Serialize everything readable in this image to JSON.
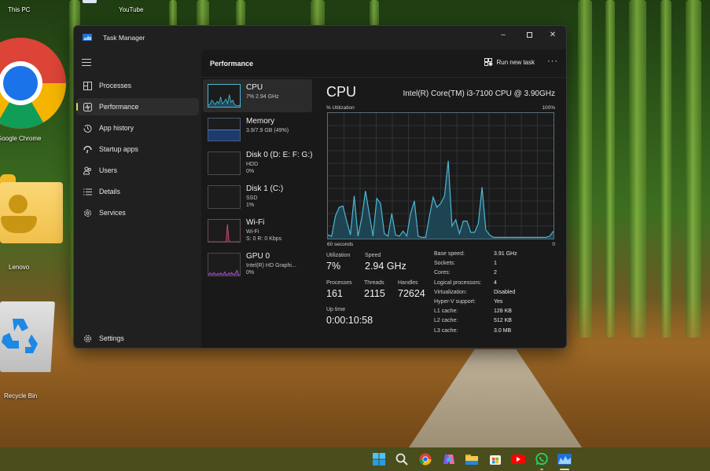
{
  "desktop": {
    "icons": [
      {
        "label": "This PC",
        "icon": "this-pc-icon"
      },
      {
        "label": "YouTube",
        "icon": "youtube-shortcut-icon"
      },
      {
        "label": "Google Chrome",
        "icon": "chrome-icon"
      },
      {
        "label": "Lenovo",
        "icon": "user-folder-icon"
      },
      {
        "label": "Recycle Bin",
        "icon": "recycle-bin-icon"
      }
    ]
  },
  "window": {
    "title": "Task Manager",
    "controls": {
      "minimize": "–",
      "maximize": "☐",
      "close": "✕"
    }
  },
  "nav": {
    "items": [
      {
        "label": "Processes",
        "icon": "processes-icon"
      },
      {
        "label": "Performance",
        "icon": "performance-icon",
        "active": true
      },
      {
        "label": "App history",
        "icon": "app-history-icon"
      },
      {
        "label": "Startup apps",
        "icon": "startup-apps-icon"
      },
      {
        "label": "Users",
        "icon": "users-icon"
      },
      {
        "label": "Details",
        "icon": "details-icon"
      },
      {
        "label": "Services",
        "icon": "services-icon"
      }
    ],
    "settings": "Settings"
  },
  "header": {
    "title": "Performance",
    "run_new_task": "Run new task",
    "more": "···"
  },
  "devices": [
    {
      "name": "CPU",
      "sub1": "7% 2.94 GHz",
      "active": true,
      "color": "#4fb6d4"
    },
    {
      "name": "Memory",
      "sub1": "3.9/7.9 GB (49%)",
      "color": "#4c7bd6"
    },
    {
      "name": "Disk 0 (D: E: F: G:)",
      "sub1": "HDD",
      "sub2": "0%",
      "color": "#6fbf4f"
    },
    {
      "name": "Disk 1 (C:)",
      "sub1": "SSD",
      "sub2": "1%",
      "color": "#6fbf4f"
    },
    {
      "name": "Wi-Fi",
      "sub1": "Wi-Fi",
      "sub2": "S: 0 R: 0 Kbps",
      "color": "#d8538a"
    },
    {
      "name": "GPU 0",
      "sub1": "Intel(R) HD Graphi...",
      "sub2": "0%",
      "color": "#b04fd0"
    }
  ],
  "cpu": {
    "title": "CPU",
    "model": "Intel(R) Core(TM) i3-7100 CPU @ 3.90GHz",
    "util_label": "% Utilization",
    "util_max": "100%",
    "axis_left": "60 seconds",
    "axis_right": "0",
    "line_color": "#4fb6d4",
    "stats": {
      "utilization_label": "Utilization",
      "utilization": "7%",
      "speed_label": "Speed",
      "speed": "2.94 GHz",
      "processes_label": "Processes",
      "processes": "161",
      "threads_label": "Threads",
      "threads": "2115",
      "handles_label": "Handles",
      "handles": "72624",
      "uptime_label": "Up time",
      "uptime": "0:00:10:58"
    },
    "specs": [
      {
        "label": "Base speed:",
        "value": "3.91 GHz"
      },
      {
        "label": "Sockets:",
        "value": "1"
      },
      {
        "label": "Cores:",
        "value": "2"
      },
      {
        "label": "Logical processors:",
        "value": "4"
      },
      {
        "label": "Virtualization:",
        "value": "Disabled"
      },
      {
        "label": "Hyper-V support:",
        "value": "Yes"
      },
      {
        "label": "L1 cache:",
        "value": "128 KB"
      },
      {
        "label": "L2 cache:",
        "value": "512 KB"
      },
      {
        "label": "L3 cache:",
        "value": "3.0 MB"
      }
    ]
  },
  "chart_data": {
    "type": "area",
    "title": "% Utilization",
    "xlabel": "60 seconds",
    "ylabel": "% Utilization",
    "xlim": [
      60,
      0
    ],
    "ylim": [
      0,
      100
    ],
    "grid": true,
    "series": [
      {
        "name": "CPU",
        "x_seconds_ago": [
          60,
          59,
          58,
          57,
          56,
          55,
          54,
          53,
          52,
          51,
          50,
          49,
          48,
          47,
          46,
          45,
          44,
          43,
          42,
          41,
          40,
          39,
          38,
          37,
          36,
          35,
          34,
          33,
          32,
          31,
          30,
          29,
          28,
          27,
          26,
          25,
          24,
          23,
          22,
          21,
          20,
          19,
          18,
          17,
          16,
          15,
          14,
          13,
          12,
          11,
          10,
          9,
          8,
          7,
          6,
          5,
          4,
          3,
          2,
          1,
          0
        ],
        "values": [
          3,
          2,
          18,
          25,
          26,
          14,
          3,
          34,
          2,
          16,
          38,
          20,
          2,
          32,
          28,
          4,
          2,
          20,
          3,
          2,
          6,
          2,
          20,
          30,
          2,
          1,
          1,
          18,
          33,
          25,
          28,
          34,
          62,
          10,
          15,
          4,
          14,
          14,
          5,
          5,
          12,
          41,
          7,
          3,
          1,
          1,
          1,
          1,
          1,
          1,
          1,
          1,
          1,
          1,
          1,
          1,
          1,
          1,
          1,
          2,
          6
        ]
      }
    ],
    "memory_util_percent": 49
  },
  "thumbnails": {
    "cpu": [
      3,
      5,
      12,
      8,
      4,
      10,
      6,
      18,
      5,
      9,
      14,
      6,
      22,
      8,
      12,
      4,
      2,
      2,
      3
    ],
    "wifi": [
      0,
      0,
      0,
      0,
      0,
      0,
      0,
      0,
      0,
      0,
      0,
      0,
      0,
      0,
      80,
      5,
      0,
      0,
      0,
      0,
      0,
      0,
      0,
      0
    ],
    "gpu": [
      2,
      10,
      8,
      4,
      12,
      6,
      3,
      8,
      5,
      10,
      4,
      6,
      14,
      4,
      3,
      10,
      6,
      12,
      5,
      3,
      12,
      20,
      4,
      2
    ]
  },
  "taskbar": {
    "apps": [
      "start-icon",
      "search-icon",
      "chrome-icon",
      "copilot-icon",
      "file-explorer-icon",
      "store-icon",
      "youtube-icon",
      "whatsapp-icon",
      "task-manager-icon"
    ]
  }
}
